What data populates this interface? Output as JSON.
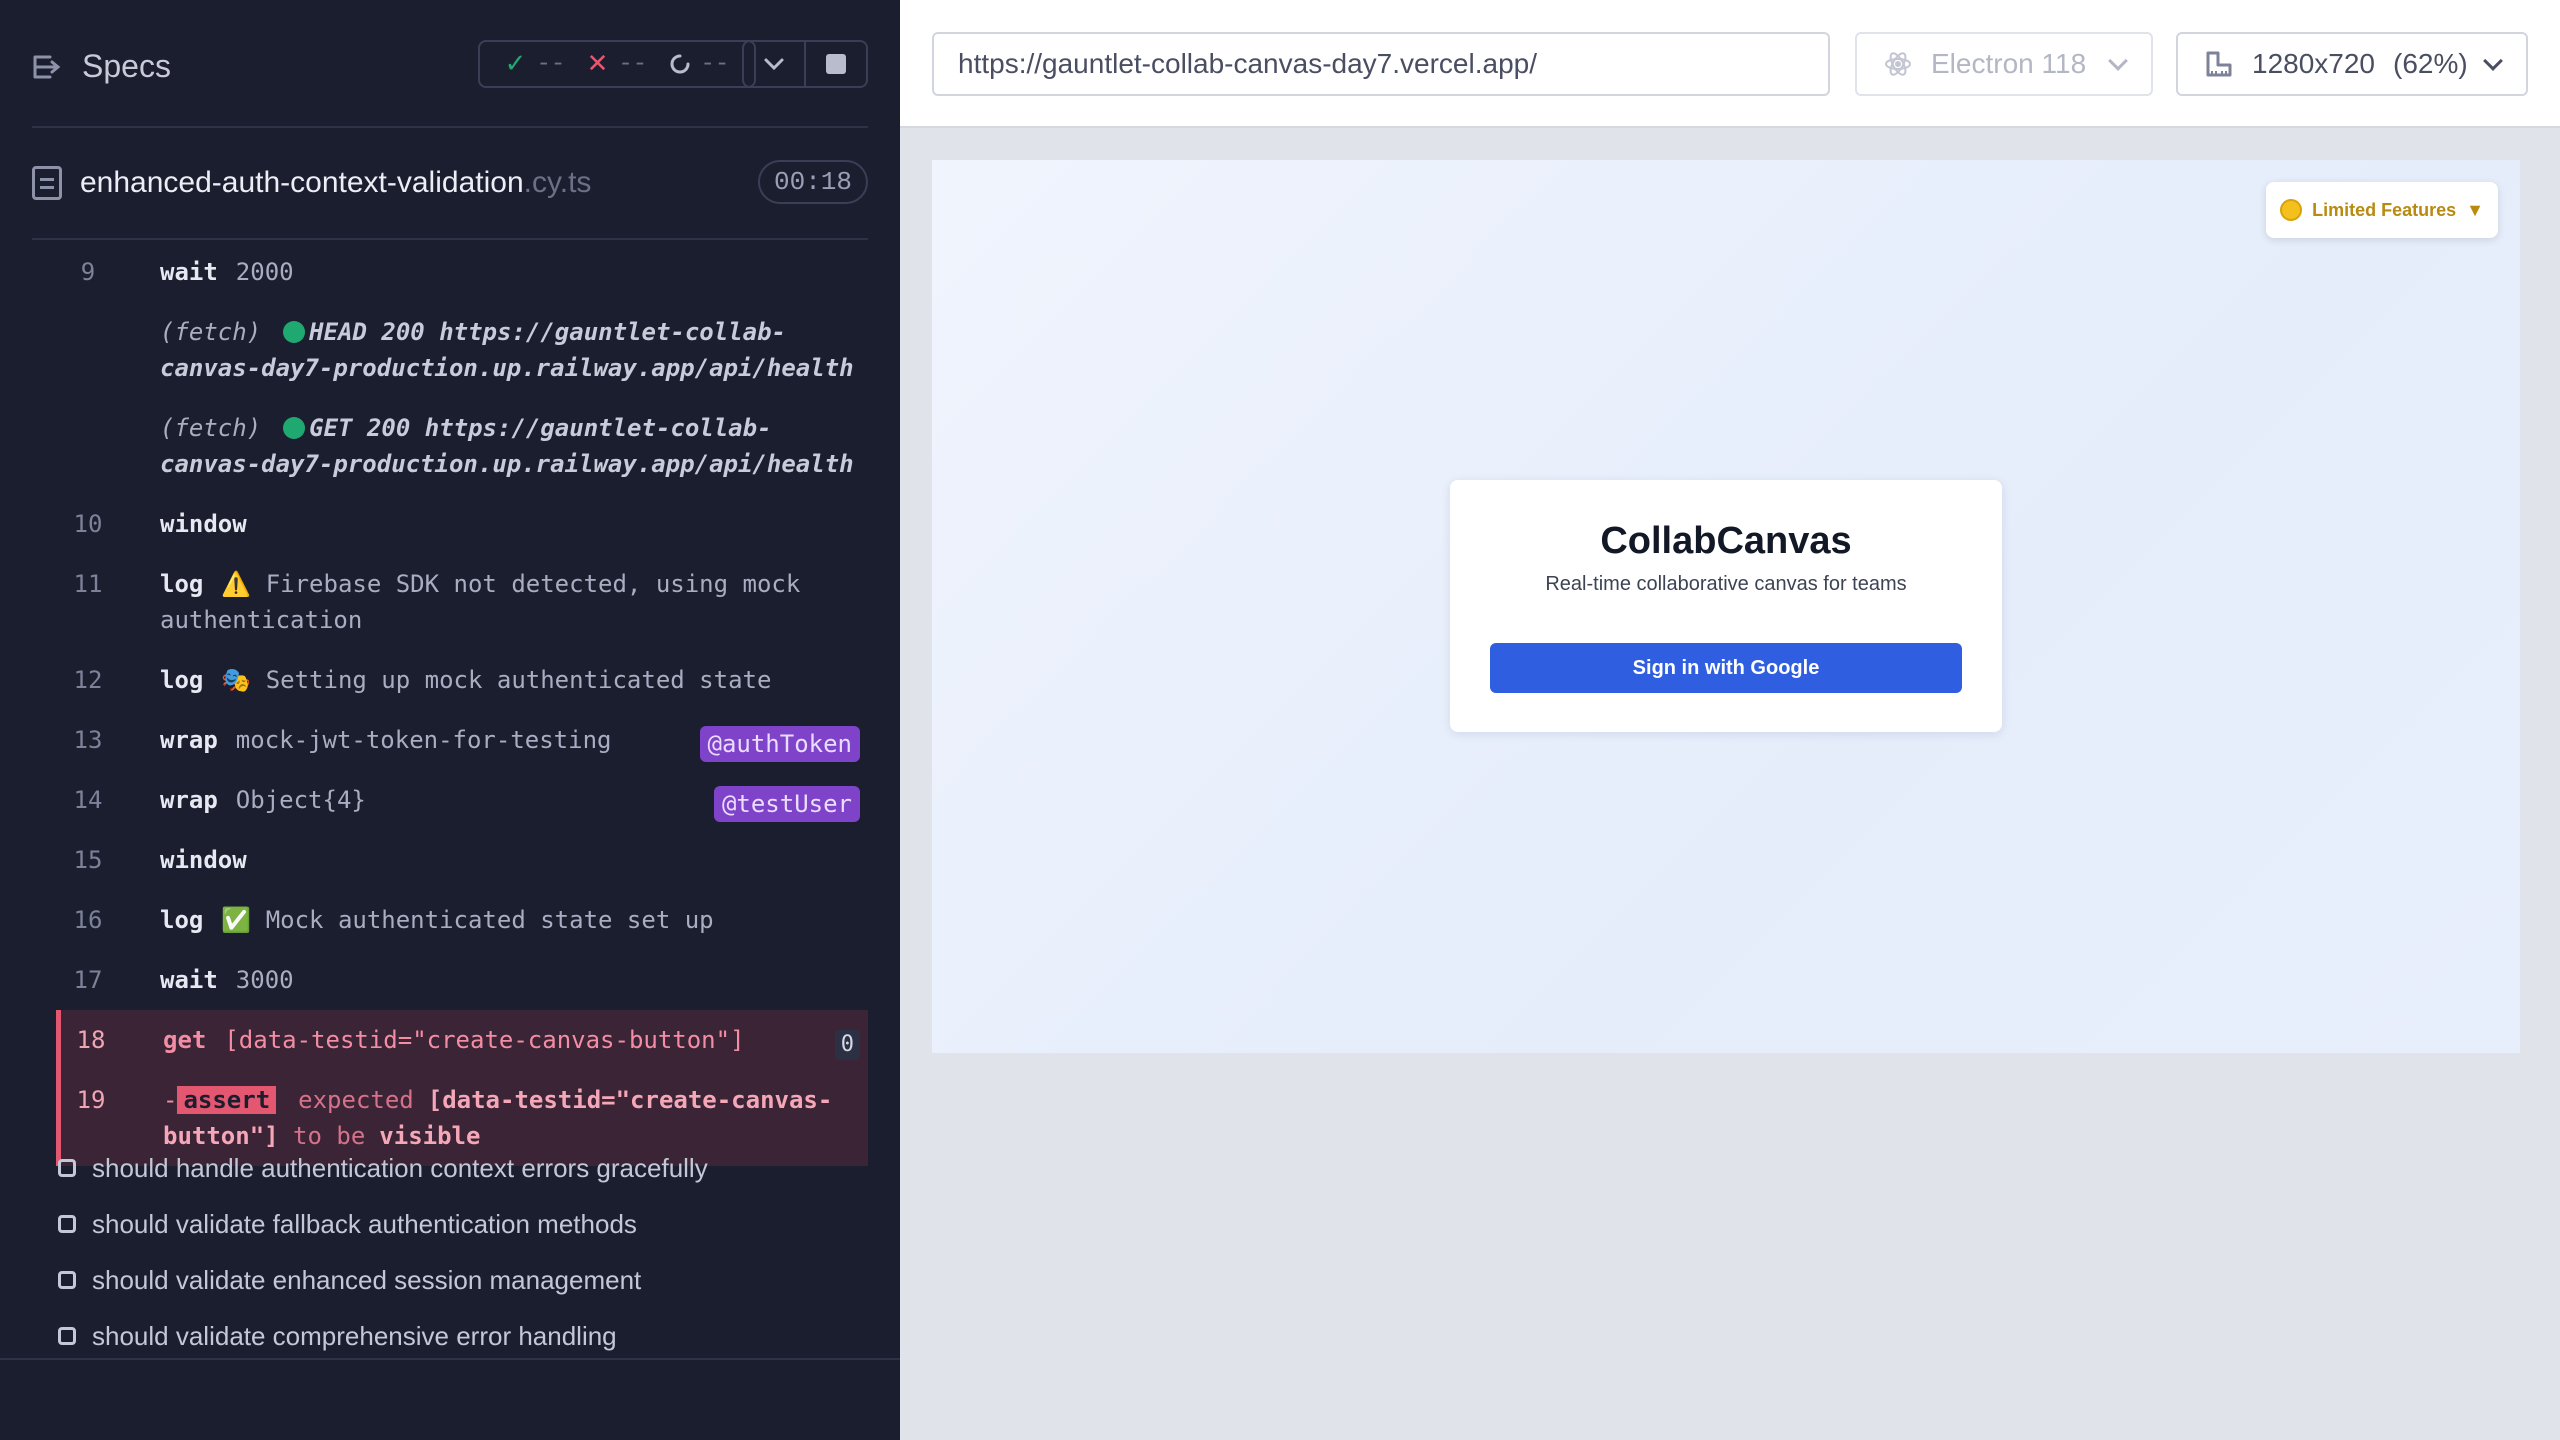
{
  "reporter": {
    "specs_label": "Specs",
    "stats": {
      "passed": "--",
      "failed": "--",
      "pending": "--"
    },
    "file": {
      "name": "enhanced-auth-context-validation",
      "ext": ".cy.ts",
      "duration": "00:18"
    },
    "commands": [
      {
        "num": "9",
        "name": "wait",
        "msg": "2000"
      },
      {
        "fetch_label": "(fetch)",
        "fetch_text": "HEAD 200 https://gauntlet-collab-canvas-day7-production.up.railway.app/api/health"
      },
      {
        "fetch_label": "(fetch)",
        "fetch_text": "GET 200 https://gauntlet-collab-canvas-day7-production.up.railway.app/api/health"
      },
      {
        "num": "10",
        "name": "window",
        "msg": ""
      },
      {
        "num": "11",
        "name": "log",
        "msg": "⚠️ Firebase SDK not detected, using mock authentication"
      },
      {
        "num": "12",
        "name": "log",
        "msg": "🎭 Setting up mock authenticated state"
      },
      {
        "num": "13",
        "name": "wrap",
        "msg": "mock-jwt-token-for-testing",
        "alias": "@authToken"
      },
      {
        "num": "14",
        "name": "wrap",
        "msg": "Object{4}",
        "alias": "@testUser"
      },
      {
        "num": "15",
        "name": "window",
        "msg": ""
      },
      {
        "num": "16",
        "name": "log",
        "msg": "✅ Mock authenticated state set up"
      },
      {
        "num": "17",
        "name": "wait",
        "msg": "3000"
      },
      {
        "num": "18",
        "name": "get",
        "msg": "[data-testid=\"create-canvas-button\"]",
        "badge": "0"
      },
      {
        "num": "19",
        "prefix": "-",
        "assert": "assert",
        "expected": "expected",
        "subject": "[data-testid=\"create-canvas-button\"]",
        "tobe": "to be",
        "visible": "visible"
      }
    ],
    "tests": [
      "should handle authentication context errors gracefully",
      "should validate fallback authentication methods",
      "should validate enhanced session management",
      "should validate comprehensive error handling"
    ]
  },
  "aut": {
    "url": "https://gauntlet-collab-canvas-day7.vercel.app/",
    "browser": "Electron 118",
    "viewport": "1280x720",
    "scale": "(62%)",
    "app": {
      "badge": "Limited Features",
      "badge_caret": "▼",
      "title": "CollabCanvas",
      "subtitle": "Real-time collaborative canvas for teams",
      "signin_label": "Sign in with Google"
    }
  },
  "colors": {
    "reporter_bg": "#1b1e2e",
    "pass": "#1fa971",
    "fail": "#e45770",
    "alias": "#7f43c9",
    "signin": "#2f5fe0",
    "badge_text": "#b98a0f"
  },
  "icons": [
    "specs-toggle-icon",
    "check-icon",
    "x-icon",
    "spinner-icon",
    "chevron-down-icon",
    "stop-icon",
    "file-icon",
    "electron-icon",
    "ruler-icon",
    "coin-icon"
  ]
}
